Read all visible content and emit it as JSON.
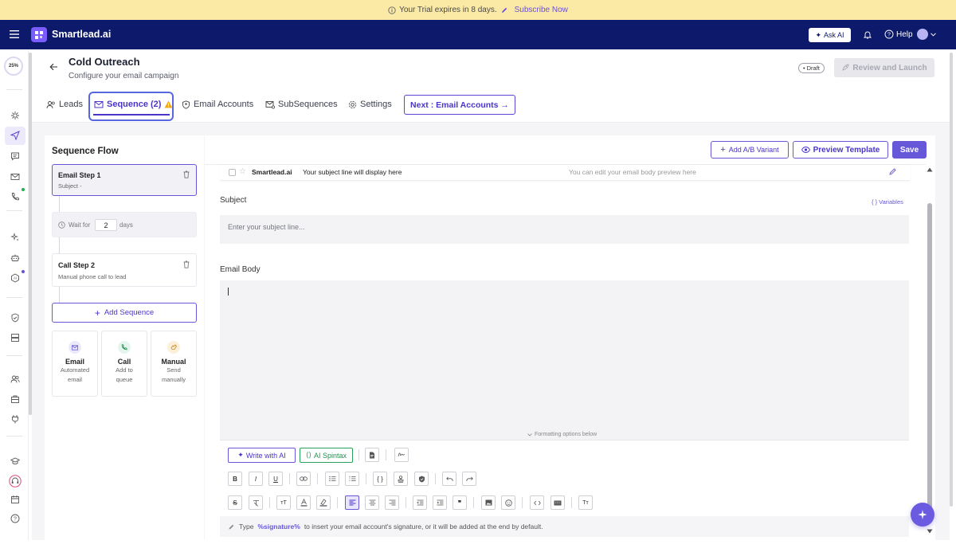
{
  "banner": {
    "text": "Your Trial expires in 8 days.",
    "link": "Subscribe Now"
  },
  "topnav": {
    "brand": "Smartlead.ai",
    "ask_ai": "Ask AI",
    "help": "Help"
  },
  "rail": {
    "progress": "25%"
  },
  "header": {
    "title": "Cold Outreach",
    "subtitle": "Configure your email campaign",
    "status": "Draft",
    "review_launch": "Review and Launch"
  },
  "tabs": [
    {
      "label": "Leads"
    },
    {
      "label": "Sequence (2)"
    },
    {
      "label": "Email Accounts"
    },
    {
      "label": "SubSequences"
    },
    {
      "label": "Settings"
    }
  ],
  "next_button": "Next : Email Accounts →",
  "sequence": {
    "title": "Sequence Flow",
    "step1": {
      "title": "Email Step 1",
      "sub": "Subject -"
    },
    "wait": {
      "prefix": "Wait for",
      "value": "2",
      "suffix": "days"
    },
    "step2": {
      "title": "Call Step 2",
      "sub": "Manual phone call to lead"
    },
    "add_label": "Add Sequence",
    "types": [
      {
        "title": "Email",
        "line1": "Automated",
        "line2": "email",
        "color": "#ece9fb",
        "icon": "mail-icon"
      },
      {
        "title": "Call",
        "line1": "Add to",
        "line2": "queue",
        "color": "#e3f5ec",
        "icon": "phone-icon"
      },
      {
        "title": "Manual",
        "line1": "Send",
        "line2": "manually",
        "color": "#fdf0da",
        "icon": "hand-icon"
      }
    ]
  },
  "editor": {
    "ab_variant": "Add A/B Variant",
    "preview_template": "Preview Template",
    "save": "Save",
    "preview_sender": "Smartlead.ai",
    "preview_subject": "Your subject line will display here",
    "preview_body": "You can edit your email body preview here",
    "subject_label": "Subject",
    "variables": "{ } Variables",
    "subject_placeholder": "Enter your subject line...",
    "body_label": "Email Body",
    "formatting_below": "Formatting options below",
    "write_ai": "Write with AI",
    "ai_spintax": "AI Spintax",
    "sig_prefix": "Type",
    "sig_token": "%signature%",
    "sig_suffix": "to insert your email account's signature, or it will be added at the end by default."
  },
  "colors": {
    "brand": "#0d1a6b",
    "accent": "#6658d8",
    "banner": "#fbe9a6"
  }
}
